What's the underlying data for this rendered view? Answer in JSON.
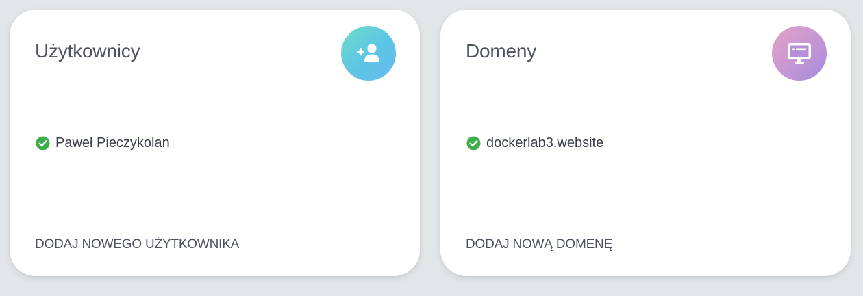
{
  "users_card": {
    "title": "Użytkownicy",
    "action_icon": "add-user-icon",
    "accent_gradient": [
      "#6fdcc9",
      "#6ab8f0"
    ],
    "items": [
      {
        "label": "Paweł Pieczykolan",
        "status": "active",
        "status_icon": "check-circle-icon"
      }
    ],
    "add_link_label": "DODAJ NOWEGO UŻYTKOWNIKA"
  },
  "domains_card": {
    "title": "Domeny",
    "action_icon": "monitor-icon",
    "accent_gradient": [
      "#e3a3c7",
      "#a58ae0"
    ],
    "items": [
      {
        "label": "dockerlab3.website",
        "status": "active",
        "status_icon": "check-circle-icon"
      }
    ],
    "add_link_label": "DODAJ NOWĄ DOMENĘ"
  },
  "colors": {
    "background": "#e3e6e9",
    "card": "#ffffff",
    "text": "#4a5160",
    "success": "#3fae4a"
  }
}
